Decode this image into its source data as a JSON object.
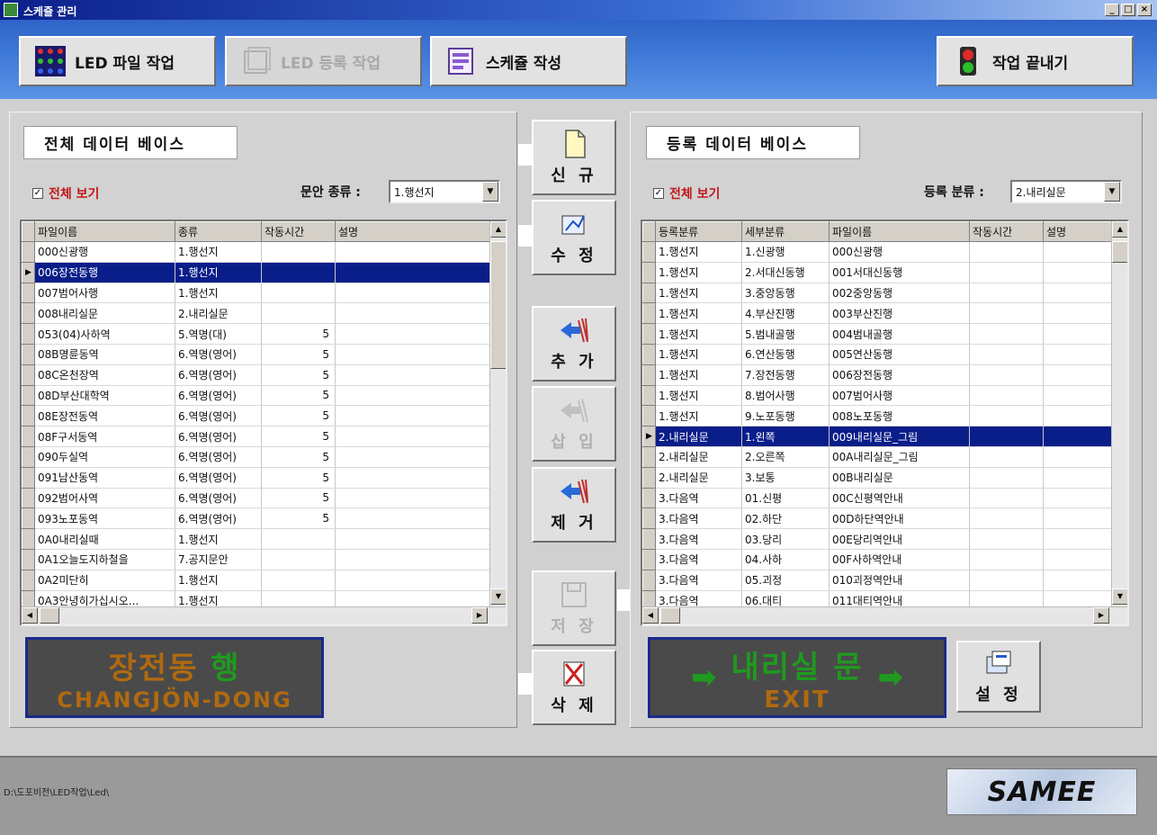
{
  "window": {
    "title": "스케쥴 관리",
    "controls": [
      "_",
      "□",
      "×"
    ]
  },
  "toolbar": {
    "led_file": "LED 파일 작업",
    "led_register": "LED 등록 작업",
    "schedule": "스케쥴 작성",
    "exit": "작업 끝내기"
  },
  "left": {
    "title": "전체 데이터 베이스",
    "checkbox_label": "전체 보기",
    "checkbox_checked": true,
    "filter_label": "문안 종류 :",
    "filter_value": "1.행선지",
    "columns": [
      "파일이름",
      "종류",
      "작동시간",
      "설명"
    ],
    "rows": [
      [
        "000신광행",
        "1.행선지",
        "",
        ""
      ],
      [
        "006장전동행",
        "1.행선지",
        "",
        ""
      ],
      [
        "007범어사행",
        "1.행선지",
        "",
        ""
      ],
      [
        "008내리실문",
        "2.내리실문",
        "",
        ""
      ],
      [
        "053(04)사하역",
        "5.역명(대)",
        "5",
        ""
      ],
      [
        "08B명륜동역",
        "6.역명(영어)",
        "5",
        ""
      ],
      [
        "08C온천장역",
        "6.역명(영어)",
        "5",
        ""
      ],
      [
        "08D부산대학역",
        "6.역명(영어)",
        "5",
        ""
      ],
      [
        "08E장전동역",
        "6.역명(영어)",
        "5",
        ""
      ],
      [
        "08F구서동역",
        "6.역명(영어)",
        "5",
        ""
      ],
      [
        "090두실역",
        "6.역명(영어)",
        "5",
        ""
      ],
      [
        "091남산동역",
        "6.역명(영어)",
        "5",
        ""
      ],
      [
        "092범어사역",
        "6.역명(영어)",
        "5",
        ""
      ],
      [
        "093노포동역",
        "6.역명(영어)",
        "5",
        ""
      ],
      [
        "0A0내리실때",
        "1.행선지",
        "",
        ""
      ],
      [
        "0A1오늘도지하철을",
        "7.공지문안",
        "",
        ""
      ],
      [
        "0A2미단히",
        "1.행선지",
        "",
        ""
      ],
      [
        "0A3안녕히가십시오...",
        "1.행선지",
        "",
        ""
      ]
    ],
    "selected_row": 1,
    "led_line1_a": "장전동",
    "led_line1_b": "행",
    "led_line2": "CHANGJÖN-DONG"
  },
  "middle": {
    "new": "신 규",
    "edit": "수 정",
    "add": "추 가",
    "insert": "삽 입",
    "remove": "제 거",
    "save": "저 장",
    "delete": "삭 제"
  },
  "right": {
    "title": "등록 데이터 베이스",
    "checkbox_label": "전체 보기",
    "checkbox_checked": true,
    "filter_label": "등록 분류 :",
    "filter_value": "2.내리실문",
    "columns": [
      "등록분류",
      "세부분류",
      "파일이름",
      "작동시간",
      "설명"
    ],
    "rows": [
      [
        "1.행선지",
        "1.신광행",
        "000신광행",
        "",
        ""
      ],
      [
        "1.행선지",
        "2.서대신동행",
        "001서대신동행",
        "",
        ""
      ],
      [
        "1.행선지",
        "3.중앙동행",
        "002중앙동행",
        "",
        ""
      ],
      [
        "1.행선지",
        "4.부산진행",
        "003부산진행",
        "",
        ""
      ],
      [
        "1.행선지",
        "5.범내골행",
        "004범내골행",
        "",
        ""
      ],
      [
        "1.행선지",
        "6.연산동행",
        "005연산동행",
        "",
        ""
      ],
      [
        "1.행선지",
        "7.장전동행",
        "006장전동행",
        "",
        ""
      ],
      [
        "1.행선지",
        "8.범어사행",
        "007범어사행",
        "",
        ""
      ],
      [
        "1.행선지",
        "9.노포동행",
        "008노포동행",
        "",
        ""
      ],
      [
        "2.내리실문",
        "1.왼쪽",
        "009내리실문_그림",
        "",
        ""
      ],
      [
        "2.내리실문",
        "2.오른쪽",
        "00A내리실문_그림",
        "",
        ""
      ],
      [
        "2.내리실문",
        "3.보통",
        "00B내리실문",
        "",
        ""
      ],
      [
        "3.다음역",
        "01.신평",
        "00C신평역안내",
        "",
        ""
      ],
      [
        "3.다음역",
        "02.하단",
        "00D하단역안내",
        "",
        ""
      ],
      [
        "3.다음역",
        "03.당리",
        "00E당리역안내",
        "",
        ""
      ],
      [
        "3.다음역",
        "04.사하",
        "00F사하역안내",
        "",
        ""
      ],
      [
        "3.다음역",
        "05.괴정",
        "010괴정역안내",
        "",
        ""
      ],
      [
        "3.다음역",
        "06.대티",
        "011대티역안내",
        "",
        ""
      ]
    ],
    "selected_row": 9,
    "led_line1": "내리실 문",
    "led_line2": "EXIT",
    "settings": "설 정"
  },
  "status": {
    "path": "D:\\도포비전\\LED작업\\Led\\",
    "logo": "SAMEE"
  },
  "colors": {
    "selection": "#0a1e8a",
    "led_orange": "#b06a10",
    "led_green": "#1f9a1f",
    "title_red": "#c01818"
  }
}
